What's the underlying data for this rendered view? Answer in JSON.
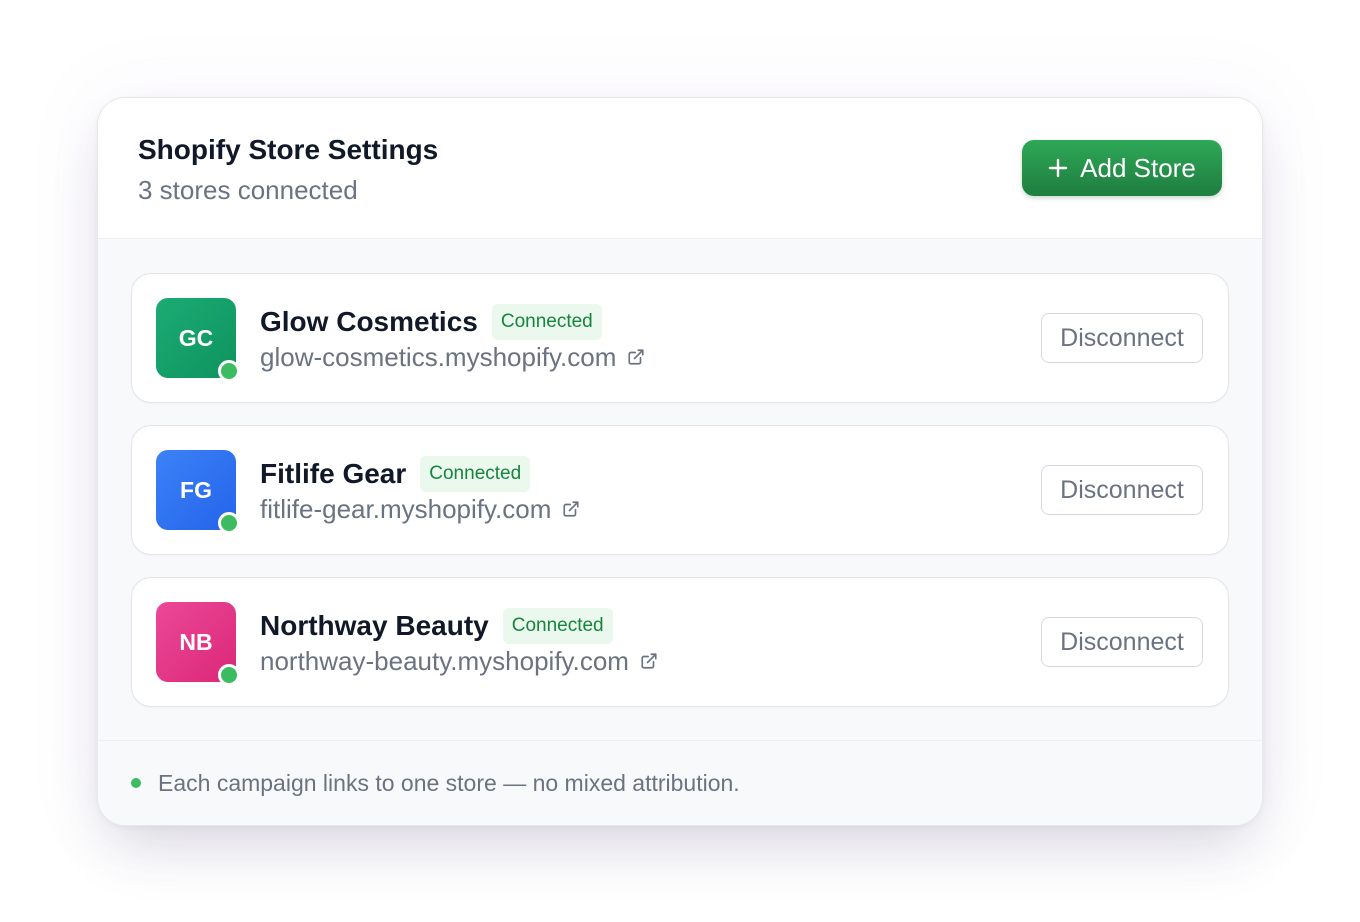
{
  "header": {
    "title": "Shopify Store Settings",
    "subtitle": "3 stores connected",
    "add_button_label": "Add Store",
    "add_button_icon": "plus-icon"
  },
  "stores": [
    {
      "initials": "GC",
      "name": "Glow Cosmetics",
      "status": "Connected",
      "domain": "glow-cosmetics.myshopify.com",
      "link_icon": "external-link-icon",
      "disconnect_label": "Disconnect",
      "avatar_colors": [
        "#1cab74",
        "#0e935f"
      ]
    },
    {
      "initials": "FG",
      "name": "Fitlife Gear",
      "status": "Connected",
      "domain": "fitlife-gear.myshopify.com",
      "link_icon": "external-link-icon",
      "disconnect_label": "Disconnect",
      "avatar_colors": [
        "#3b82f6",
        "#2563eb"
      ]
    },
    {
      "initials": "NB",
      "name": "Northway Beauty",
      "status": "Connected",
      "domain": "northway-beauty.myshopify.com",
      "link_icon": "external-link-icon",
      "disconnect_label": "Disconnect",
      "avatar_colors": [
        "#ec4899",
        "#db2777"
      ]
    }
  ],
  "footer": {
    "note": "Each campaign links to one store — no mixed attribution."
  },
  "colors": {
    "accent_green": "#2ea857",
    "accent_green_dark": "#1f7d40",
    "status_online": "#3dbb61",
    "badge_bg": "#eaf8ee",
    "badge_text": "#17853e",
    "title_text": "#111827",
    "muted_text": "#6b7280"
  }
}
